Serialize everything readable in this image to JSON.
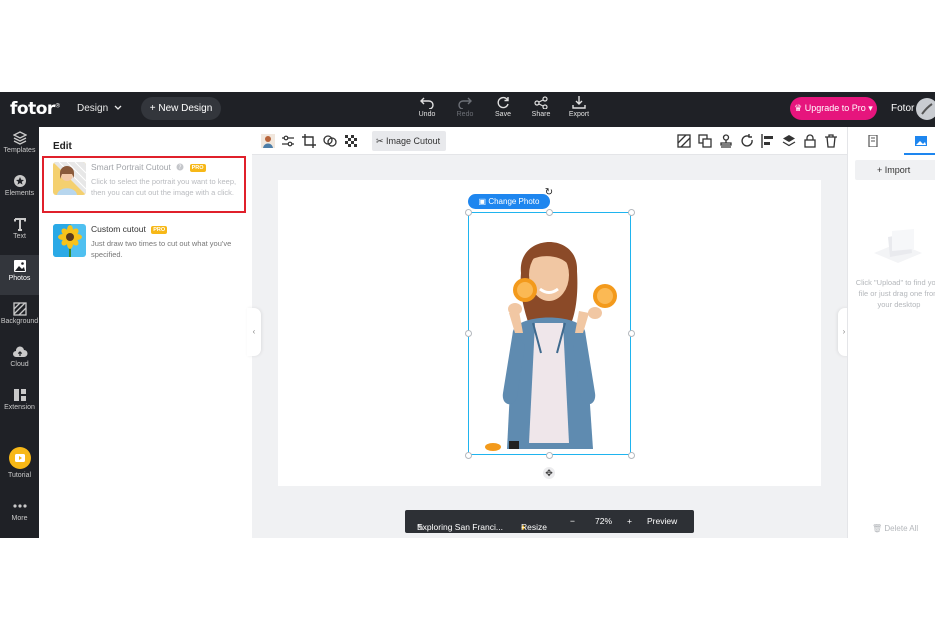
{
  "topbar": {
    "logo": "fotor",
    "logo_mark": "®",
    "design_menu": "Design",
    "new_design": "New Design",
    "tools": [
      {
        "label": "Undo",
        "icon": "undo-icon",
        "enabled": true
      },
      {
        "label": "Redo",
        "icon": "redo-icon",
        "enabled": false
      },
      {
        "label": "Save",
        "icon": "save-icon",
        "enabled": true
      },
      {
        "label": "Share",
        "icon": "share-icon",
        "enabled": true
      },
      {
        "label": "Export",
        "icon": "export-icon",
        "enabled": true
      }
    ],
    "upgrade": "Upgrade to Pro",
    "user_name": "Fotor"
  },
  "rail": {
    "items": [
      {
        "label": "Templates",
        "icon": "layers-icon"
      },
      {
        "label": "Elements",
        "icon": "elements-icon"
      },
      {
        "label": "Text",
        "icon": "text-icon"
      },
      {
        "label": "Photos",
        "icon": "photos-icon",
        "active": true
      },
      {
        "label": "Background",
        "icon": "background-icon"
      },
      {
        "label": "Cloud",
        "icon": "cloud-icon"
      },
      {
        "label": "Extension",
        "icon": "extension-icon"
      },
      {
        "label": "Tutorial",
        "icon": "tutorial-icon"
      },
      {
        "label": "More",
        "icon": "more-icon"
      }
    ]
  },
  "panel": {
    "title": "Edit",
    "features": [
      {
        "title": "Smart Portrait Cutout",
        "badge": "PRO",
        "desc": "Click to select the portrait you want to keep, then you can cut out the image with a click."
      },
      {
        "title": "Custom cutout",
        "badge": "PRO",
        "desc": "Just draw two times to cut out what you've specified."
      }
    ]
  },
  "toolbar": {
    "cutout_label": "Image Cutout"
  },
  "canvas": {
    "change_photo": "Change Photo"
  },
  "bottombar": {
    "project_name": "Exploring San Franci...",
    "resize": "Resize",
    "zoom_out": "−",
    "zoom": "72%",
    "zoom_in": "+",
    "preview": "Preview"
  },
  "rightpanel": {
    "import": "Import",
    "hint": "Click \"Upload\" to find your file or just drag one from your desktop",
    "delete_all": "Delete All"
  },
  "colors": {
    "topbar_bg": "#1f2126",
    "upgrade_bg": "#e6157d",
    "accent_blue": "#1e86ef",
    "selection": "#1fb4ef",
    "highlight_red": "#e0202b",
    "pro_badge": "#f7b817"
  }
}
